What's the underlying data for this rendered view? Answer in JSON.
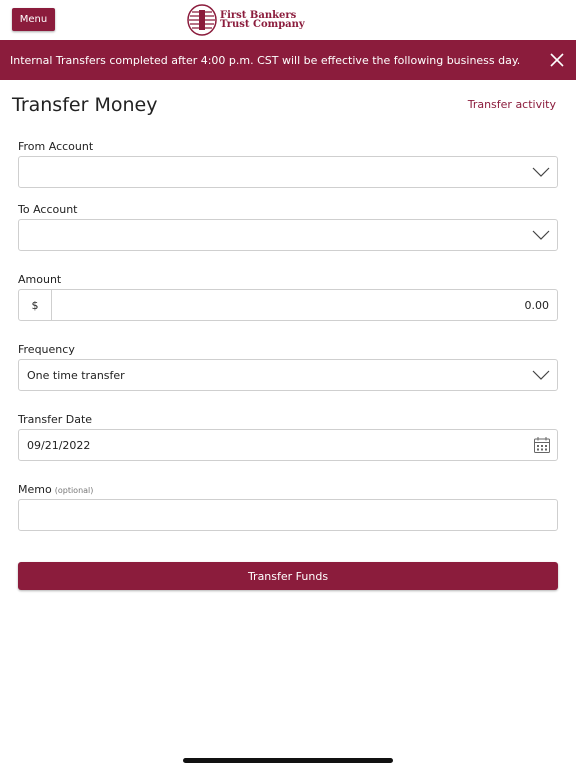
{
  "header": {
    "menu_label": "Menu",
    "logo_line1": "First Bankers",
    "logo_line2": "Trust Company"
  },
  "banner": {
    "message": "Internal Transfers completed after 4:00 p.m. CST will be effective the following business day."
  },
  "page": {
    "title": "Transfer Money",
    "activity_link": "Transfer activity"
  },
  "form": {
    "from_account": {
      "label": "From Account",
      "value": ""
    },
    "to_account": {
      "label": "To Account",
      "value": ""
    },
    "amount": {
      "label": "Amount",
      "prefix": "$",
      "value": "0.00"
    },
    "frequency": {
      "label": "Frequency",
      "value": "One time transfer"
    },
    "transfer_date": {
      "label": "Transfer Date",
      "value": "09/21/2022"
    },
    "memo": {
      "label": "Memo",
      "optional": "(optional)",
      "value": ""
    },
    "submit_label": "Transfer Funds"
  },
  "colors": {
    "brand": "#8b1c3c"
  },
  "icons": {
    "close": "close-icon",
    "dropdown": "chevron-down-icon",
    "calendar": "calendar-icon"
  }
}
